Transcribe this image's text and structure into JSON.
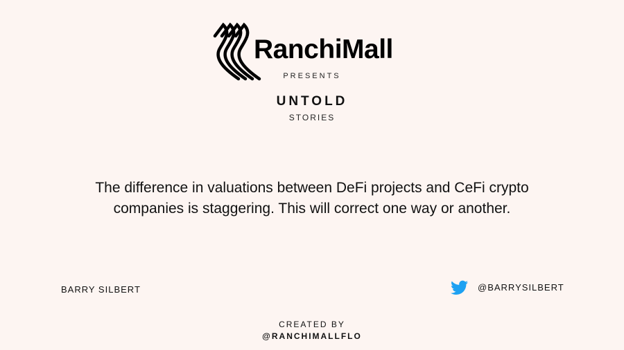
{
  "brand": {
    "name": "RanchiMall",
    "logo_icon": "ranchimall-logo-icon"
  },
  "header": {
    "presents": "PRESENTS",
    "title": "UNTOLD",
    "subtitle": "STORIES"
  },
  "quote": {
    "text": "The difference in valuations between DeFi projects and CeFi crypto companies is staggering. This will correct one way or another."
  },
  "attribution": {
    "author": "BARRY SILBERT",
    "twitter_icon": "twitter-bird-icon",
    "twitter_handle": "@BARRYSILBERT"
  },
  "footer": {
    "created_by": "CREATED BY",
    "creator_handle": "@RANCHIMALLFLO"
  },
  "colors": {
    "background": "#fdf5f2",
    "text": "#111111",
    "twitter": "#1da1f2"
  }
}
